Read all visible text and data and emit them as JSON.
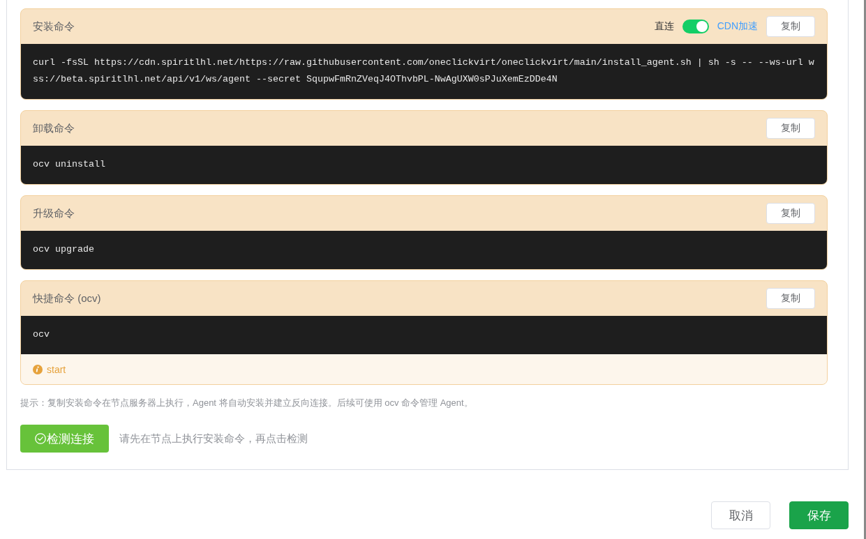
{
  "commands": [
    {
      "title": "安装命令",
      "switch": {
        "inactive_label": "直连",
        "active_label": "CDN加速",
        "on": true
      },
      "copy_label": "复制",
      "code": "curl -fsSL https://cdn.spiritlhl.net/https://raw.githubusercontent.com/oneclickvirt/oneclickvirt/main/install_agent.sh | sh -s -- --ws-url wss://beta.spiritlhl.net/api/v1/ws/agent --secret SqupwFmRnZVeqJ4OThvbPL-NwAgUXW0sPJuXemEzDDe4N"
    },
    {
      "title": "卸载命令",
      "copy_label": "复制",
      "code": "ocv uninstall"
    },
    {
      "title": "升级命令",
      "copy_label": "复制",
      "code": "ocv upgrade"
    },
    {
      "title": "快捷命令 (ocv)",
      "copy_label": "复制",
      "code": "ocv",
      "note": "start"
    }
  ],
  "hint": "提示：复制安装命令在节点服务器上执行，Agent 将自动安装并建立反向连接。后续可使用 ocv 命令管理 Agent。",
  "check": {
    "button": "检测连接",
    "message": "请先在节点上执行安装命令，再点击检测"
  },
  "footer_buttons": [
    {
      "label": "取消",
      "kind": "default"
    },
    {
      "label": "保存",
      "kind": "primary"
    }
  ]
}
